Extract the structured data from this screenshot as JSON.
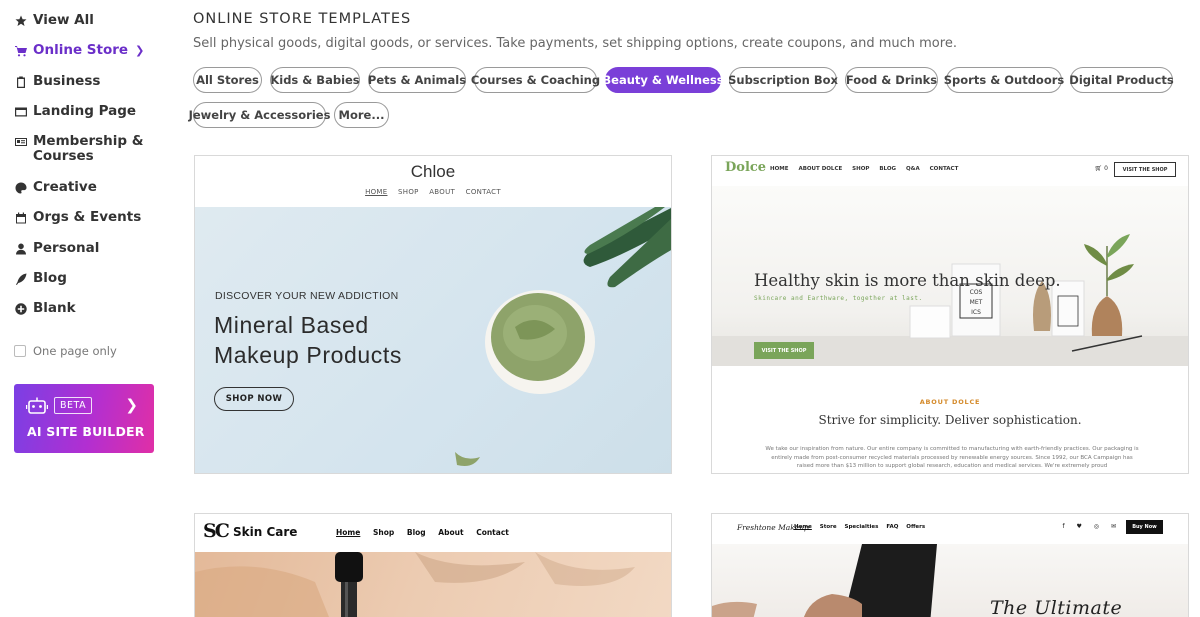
{
  "sidebar": {
    "items": [
      {
        "label": "View All",
        "icon": "star-icon"
      },
      {
        "label": "Online Store",
        "icon": "cart-icon",
        "active": true
      },
      {
        "label": "Business",
        "icon": "clipboard-icon"
      },
      {
        "label": "Landing Page",
        "icon": "window-icon"
      },
      {
        "label": "Membership & Courses",
        "icon": "id-card-icon"
      },
      {
        "label": "Creative",
        "icon": "palette-icon"
      },
      {
        "label": "Orgs & Events",
        "icon": "calendar-icon"
      },
      {
        "label": "Personal",
        "icon": "person-icon"
      },
      {
        "label": "Blog",
        "icon": "quill-icon"
      },
      {
        "label": "Blank",
        "icon": "plus-circle-icon"
      }
    ],
    "one_page_only": "One page only",
    "ai_builder": {
      "beta": "BETA",
      "label": "AI SITE BUILDER"
    }
  },
  "header": {
    "title": "ONLINE STORE TEMPLATES",
    "subtitle": "Sell physical goods, digital goods, or services. Take payments, set shipping options, create coupons, and much more."
  },
  "filters": [
    {
      "label": "All Stores"
    },
    {
      "label": "Kids & Babies"
    },
    {
      "label": "Pets & Animals"
    },
    {
      "label": "Courses & Coaching"
    },
    {
      "label": "Beauty & Wellness",
      "selected": true
    },
    {
      "label": "Subscription Box"
    },
    {
      "label": "Food & Drinks"
    },
    {
      "label": "Sports & Outdoors"
    },
    {
      "label": "Digital Products"
    },
    {
      "label": "Jewelry & Accessories"
    },
    {
      "label": "More..."
    }
  ],
  "templates": {
    "chloe": {
      "logo": "Chloe",
      "nav": [
        "HOME",
        "SHOP",
        "ABOUT",
        "CONTACT"
      ],
      "kicker": "DISCOVER YOUR NEW ADDICTION",
      "headline_1": "Mineral Based",
      "headline_2": "Makeup Products",
      "button": "SHOP NOW"
    },
    "dolce": {
      "logo": "Dolce",
      "nav": [
        "HOME",
        "ABOUT DOLCE",
        "SHOP",
        "BLOG",
        "Q&A",
        "CONTACT"
      ],
      "cart": "0",
      "visit_button": "VISIT THE SHOP",
      "headline": "Healthy skin is more than skin deep.",
      "tagline": "Skincare and Earthware, together at last.",
      "cta": "VISIT THE SHOP",
      "about_label": "ABOUT DOLCE",
      "about_title": "Strive for simplicity. Deliver sophistication.",
      "about_text": "We take our inspiration from nature. Our entire company is committed to manufacturing with earth-friendly practices. Our packaging is entirely made from post-consumer recycled materials processed by renewable energy sources. Since 1992, our BCA Campaign has raised more than $13 million to support global research, education and medical services. We're extremely proud",
      "box_text": "COS\nMET\nICS"
    },
    "skincare": {
      "logo": "SC",
      "name": "Skin Care",
      "nav": [
        "Home",
        "Shop",
        "Blog",
        "About",
        "Contact"
      ]
    },
    "freshtone": {
      "logo": "Freshtone Makeup",
      "nav": [
        "Home",
        "Store",
        "Specialties",
        "FAQ",
        "Offers"
      ],
      "social": [
        "f",
        "♥",
        "◎",
        "✉"
      ],
      "buy": "Buy Now",
      "headline": "The Ultimate Palette"
    }
  },
  "colors": {
    "accent": "#7a3fd8",
    "dolce_green": "#7aa55a",
    "dolce_orange": "#d48a2a"
  }
}
